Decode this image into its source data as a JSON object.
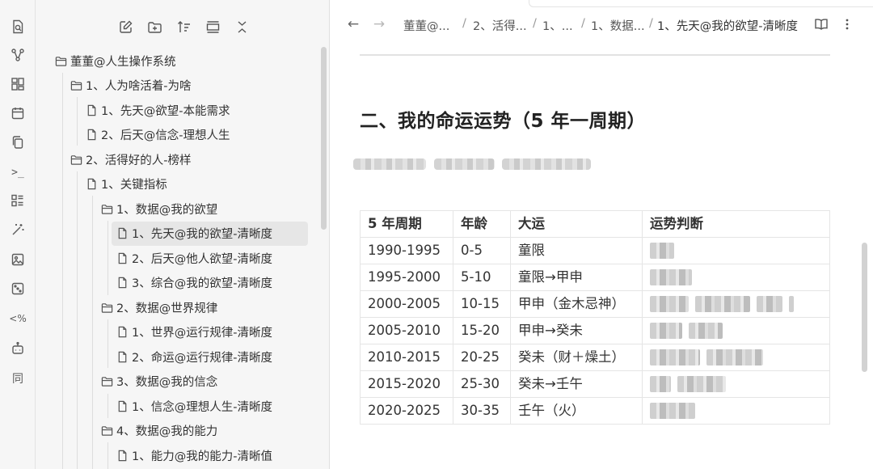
{
  "ribbon": {
    "icons": [
      "search-icon",
      "graph-icon",
      "layout-grid-icon",
      "calendar-icon",
      "copy-icon",
      "terminal-icon",
      "list-icon",
      "magic-wand-icon",
      "image-icon",
      "dice-icon",
      "percent-template-icon",
      "robot-icon",
      "sync-icon"
    ],
    "terminal_glyph": ">_",
    "percent_glyph": "<%",
    "sync_glyph": "同"
  },
  "sidebar": {
    "toolbar": [
      "new-note-icon",
      "new-folder-icon",
      "sort-icon",
      "collapse-all-icon",
      "close-icon"
    ],
    "tree": [
      {
        "label": "董董@人生操作系统",
        "type": "folder"
      },
      {
        "label": "1、人为啥活着-为啥",
        "type": "folder"
      },
      {
        "label": "1、先天@欲望-本能需求",
        "type": "file"
      },
      {
        "label": "2、后天@信念-理想人生",
        "type": "file"
      },
      {
        "label": "2、活得好的人-榜样",
        "type": "folder"
      },
      {
        "label": "1、关键指标",
        "type": "file"
      },
      {
        "label": "1、数据@我的欲望",
        "type": "folder"
      },
      {
        "label": "1、先天@我的欲望-清晰度",
        "type": "file",
        "active": true
      },
      {
        "label": "2、后天@他人欲望-清晰度",
        "type": "file"
      },
      {
        "label": "3、综合@我的欲望-清晰度",
        "type": "file"
      },
      {
        "label": "2、数据@世界规律",
        "type": "folder"
      },
      {
        "label": "1、世界@运行规律-清晰度",
        "type": "file"
      },
      {
        "label": "2、命运@运行规律-清晰度",
        "type": "file"
      },
      {
        "label": "3、数据@我的信念",
        "type": "folder"
      },
      {
        "label": "1、信念@理想人生-清晰度",
        "type": "file"
      },
      {
        "label": "4、数据@我的能力",
        "type": "folder"
      },
      {
        "label": "1、能力@我的能力-清晰值",
        "type": "file"
      }
    ]
  },
  "main": {
    "nav_back": "←",
    "nav_forward": "→",
    "breadcrumb": [
      "董董@...",
      "2、活得...",
      "1、...",
      "1、数据...",
      "1、先天@我的欲望-清晰度"
    ],
    "breadcrumb_sep": "/",
    "heading": "二、我的命运运势（5 年一周期）",
    "table": {
      "headers": [
        "5 年周期",
        "年龄",
        "大运",
        "运势判断"
      ],
      "rows": [
        {
          "period": "1990-1995",
          "age": "0-5",
          "luck": "童限"
        },
        {
          "period": "1995-2000",
          "age": "5-10",
          "luck": "童限→甲申"
        },
        {
          "period": "2000-2005",
          "age": "10-15",
          "luck": "甲申（金木忌神）"
        },
        {
          "period": "2005-2010",
          "age": "15-20",
          "luck": "甲申→癸未"
        },
        {
          "period": "2010-2015",
          "age": "20-25",
          "luck": "癸未（财＋燥土）"
        },
        {
          "period": "2015-2020",
          "age": "25-30",
          "luck": "癸未→壬午"
        },
        {
          "period": "2020-2025",
          "age": "30-35",
          "luck": "壬午（火）"
        }
      ]
    }
  }
}
